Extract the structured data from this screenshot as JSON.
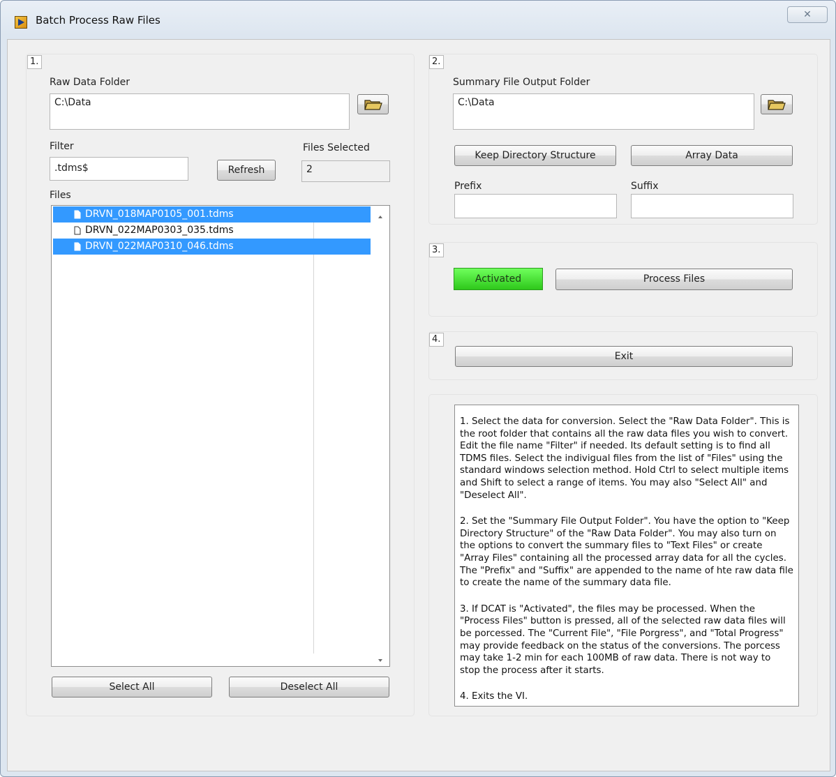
{
  "window": {
    "title": "Batch Process Raw Files",
    "close_glyph": "✕"
  },
  "section1": {
    "number": "1.",
    "raw_data_folder_label": "Raw Data Folder",
    "raw_data_folder_value": "C:\\Data",
    "filter_label": "Filter",
    "filter_value": ".tdms$",
    "refresh_label": "Refresh",
    "files_selected_label": "Files Selected",
    "files_selected_value": "2",
    "files_label": "Files",
    "files": [
      {
        "name": "DRVN_018MAP0105_001.tdms",
        "selected": true
      },
      {
        "name": "DRVN_022MAP0303_035.tdms",
        "selected": false
      },
      {
        "name": "DRVN_022MAP0310_046.tdms",
        "selected": true
      }
    ],
    "select_all_label": "Select All",
    "deselect_all_label": "Deselect All"
  },
  "section2": {
    "number": "2.",
    "output_folder_label": "Summary File Output Folder",
    "output_folder_value": "C:\\Data",
    "keep_directory_label": "Keep Directory Structure",
    "array_data_label": "Array Data",
    "prefix_label": "Prefix",
    "prefix_value": "",
    "suffix_label": "Suffix",
    "suffix_value": ""
  },
  "section3": {
    "number": "3.",
    "status_label": "Activated",
    "process_files_label": "Process Files"
  },
  "section4": {
    "number": "4.",
    "exit_label": "Exit"
  },
  "help": {
    "paragraphs": [
      "1. Select the data for conversion. Select the \"Raw Data Folder\". This is the root folder that contains all the raw data files you wish to convert. Edit the file name \"Filter\" if needed. Its default setting is to find all TDMS files. Select the indivigual files from the list of \"Files\" using the standard windows selection method. Hold Ctrl to select multiple items and Shift to select a range of items. You may also \"Select All\" and \"Deselect All\".",
      "2. Set the \"Summary File Output Folder\". You have the option to \"Keep Directory Structure\" of the \"Raw Data Folder\". You may also turn on the options to convert the summary files to \"Text Files\" or create \"Array Files\" containing all the processed array data for all the cycles. The \"Prefix\" and \"Suffix\" are appended to the name of hte raw data file to create the name of the summary data file.",
      "3. If DCAT is \"Activated\", the files may be processed. When the \"Process Files\" button is pressed, all of the selected raw data files will be porcessed. The \"Current File\", \"File Porgress\", and \"Total Progress\" may provide feedback on the status of the conversions. The porcess may take 1-2 min for each 100MB of raw data. There is not way to stop the process after it starts.",
      "4. Exits the VI."
    ]
  },
  "colors": {
    "selection": "#3399ff",
    "activated": "#3fe02a"
  },
  "icons": {
    "app": "labview-vi-icon",
    "folder": "folder-open-icon",
    "file": "document-icon"
  }
}
